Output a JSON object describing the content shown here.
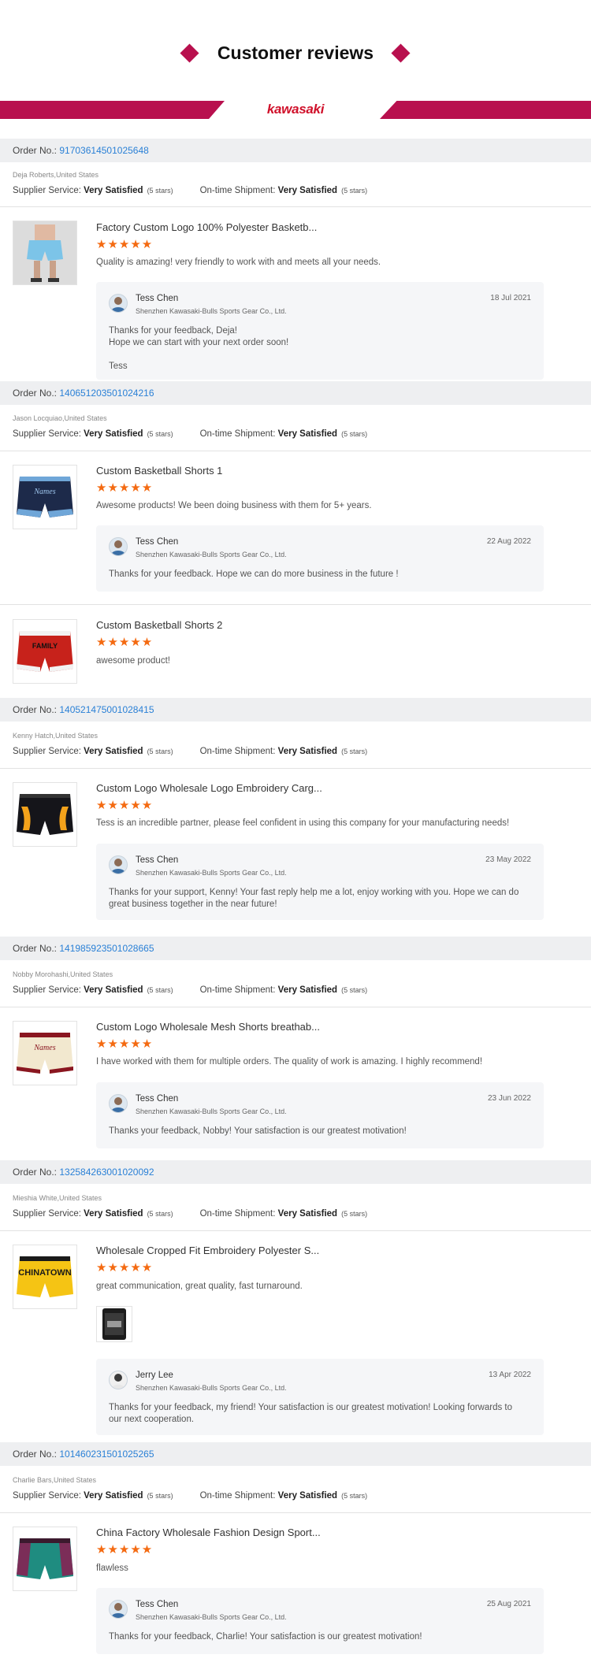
{
  "header": {
    "title": "Customer reviews",
    "logo": "kawasaki"
  },
  "labels": {
    "order_prefix": "Order No.: ",
    "supplier_service": "Supplier Service: ",
    "ontime_shipment": "On-time Shipment: ",
    "company": "Shenzhen Kawasaki-Bulls Sports Gear Co., Ltd."
  },
  "colors": {
    "brand": "#b8104e",
    "stars": "#f46a11",
    "order_link": "#2a80d6"
  },
  "orders": [
    {
      "order_no": "91703614501025648",
      "buyer": "Deja Roberts,United States",
      "supplier_rating": "Very Satisfied",
      "supplier_stars": "(5 stars)",
      "shipment_rating": "Very Satisfied",
      "shipment_stars": "(5 stars)",
      "products": [
        {
          "name": "Factory Custom Logo 100% Polyester Basketb...",
          "stars": "★★★★★",
          "review": "Quality is amazing! very friendly to work with and meets all your needs.",
          "reply": {
            "name": "Tess Chen",
            "date": "18 Jul 2021",
            "lines": [
              "Thanks for your feedback, Deja!",
              "Hope we can start with your next order soon!",
              "",
              "Tess"
            ]
          }
        }
      ]
    },
    {
      "order_no": "140651203501024216",
      "buyer": "Jason Locquiao,United States",
      "supplier_rating": "Very Satisfied",
      "supplier_stars": "(5 stars)",
      "shipment_rating": "Very Satisfied",
      "shipment_stars": "(5 stars)",
      "products": [
        {
          "name": "Custom Basketball Shorts 1",
          "stars": "★★★★★",
          "review": "Awesome products! We been doing business with them for 5+ years.",
          "reply": {
            "name": "Tess Chen",
            "date": "22 Aug 2022",
            "lines": [
              "Thanks for your feedback. Hope we can do more business in the future !"
            ]
          }
        },
        {
          "name": "Custom Basketball Shorts 2",
          "stars": "★★★★★",
          "review": "awesome product!"
        }
      ]
    },
    {
      "order_no": "140521475001028415",
      "buyer": "Kenny Hatch,United States",
      "supplier_rating": "Very Satisfied",
      "supplier_stars": "(5 stars)",
      "shipment_rating": "Very Satisfied",
      "shipment_stars": "(5 stars)",
      "products": [
        {
          "name": "Custom Logo Wholesale Logo Embroidery Carg...",
          "stars": "★★★★★",
          "review": "Tess is an incredible partner, please feel confident in using this company for your manufacturing needs!",
          "reply": {
            "name": "Tess Chen",
            "date": "23 May 2022",
            "lines": [
              "Thanks for your support, Kenny! Your fast reply  help me a lot, enjoy working with you. Hope we can do great business together in the near future!"
            ]
          }
        }
      ]
    },
    {
      "order_no": "141985923501028665",
      "buyer": "Nobby Morohashi,United States",
      "supplier_rating": "Very Satisfied",
      "supplier_stars": "(5 stars)",
      "shipment_rating": "Very Satisfied",
      "shipment_stars": "(5 stars)",
      "products": [
        {
          "name": "Custom Logo Wholesale Mesh Shorts breathab...",
          "stars": "★★★★★",
          "review": "I have worked with them for multiple orders. The quality of work is amazing. I highly recommend!",
          "reply": {
            "name": "Tess Chen",
            "date": "23 Jun 2022",
            "lines": [
              "Thanks your feedback, Nobby!  Your satisfaction is our greatest motivation!"
            ]
          }
        }
      ]
    },
    {
      "order_no": "132584263001020092",
      "buyer": "Mieshia White,United States",
      "supplier_rating": "Very Satisfied",
      "supplier_stars": "(5 stars)",
      "shipment_rating": "Very Satisfied",
      "shipment_stars": "(5 stars)",
      "products": [
        {
          "name": "Wholesale Cropped Fit Embroidery Polyester S...",
          "stars": "★★★★★",
          "review": "great communication, great quality, fast turnaround.",
          "reply": {
            "name": "Jerry Lee",
            "date": "13 Apr 2022",
            "lines": [
              "Thanks for your feedback, my friend! Your satisfaction is our greatest motivation! Looking forwards to our next cooperation."
            ]
          }
        }
      ]
    },
    {
      "order_no": "101460231501025265",
      "buyer": "Charlie Bars,United States",
      "supplier_rating": "Very Satisfied",
      "supplier_stars": "(5 stars)",
      "shipment_rating": "Very Satisfied",
      "shipment_stars": "(5 stars)",
      "products": [
        {
          "name": "China Factory Wholesale Fashion Design Sport...",
          "stars": "★★★★★",
          "review": "flawless",
          "reply": {
            "name": "Tess Chen",
            "date": "25 Aug 2021",
            "lines": [
              "Thanks for your feedback, Charlie! Your satisfaction is our greatest motivation!"
            ]
          }
        }
      ]
    }
  ]
}
